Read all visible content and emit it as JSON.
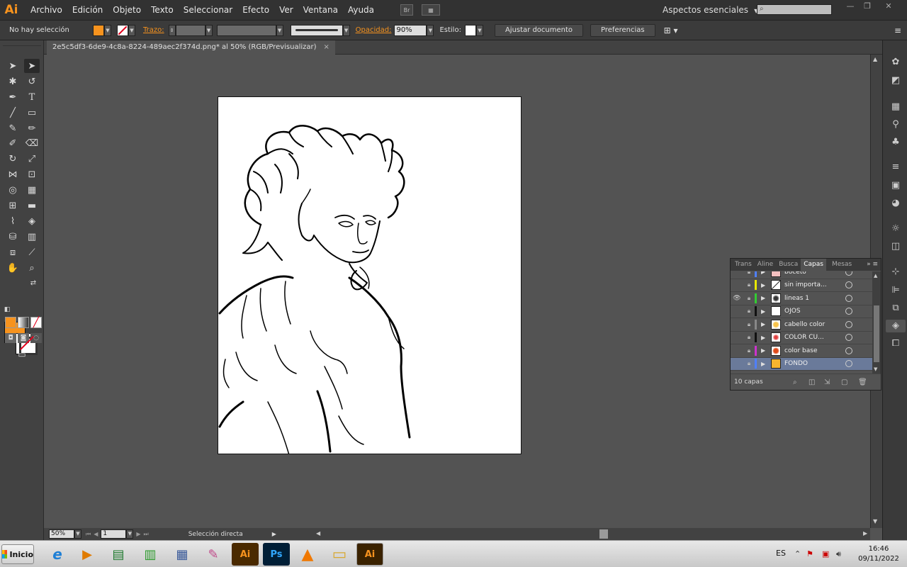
{
  "app": {
    "logo": "Ai",
    "window_controls": [
      "—",
      "❐",
      "✕"
    ]
  },
  "menu": [
    "Archivo",
    "Edición",
    "Objeto",
    "Texto",
    "Seleccionar",
    "Efecto",
    "Ver",
    "Ventana",
    "Ayuda"
  ],
  "menu_buttons": [
    "Br",
    "▦"
  ],
  "workspace": {
    "label": "Aspectos esenciales"
  },
  "control_bar": {
    "selection": "No hay selección",
    "stroke_label": "Trazo:",
    "opacity_label": "Opacidad:",
    "opacity_value": "90%",
    "style_label": "Estilo:",
    "adjust_button": "Ajustar documento",
    "preferences_button": "Preferencias",
    "fill_color": "#f7931e"
  },
  "document_tab": {
    "title": "2e5c5df3-6de9-4c8a-8224-489aec2f374d.png* al 50% (RGB/Previsualizar)",
    "close": "×"
  },
  "status_bar": {
    "zoom": "50%",
    "artboard": "1",
    "tool": "Selección directa"
  },
  "layers_panel": {
    "tabs": [
      "Trans",
      "Aline",
      "Busca",
      "Capas",
      "Mesas"
    ],
    "active_tab": "Capas",
    "layers": [
      {
        "name": "boceto",
        "color": "#4f80ff",
        "visible": false,
        "selected": false
      },
      {
        "name": "sin importa...",
        "color": "#e8e800",
        "visible": false,
        "selected": false
      },
      {
        "name": "lineas 1",
        "color": "#33cc33",
        "visible": true,
        "selected": false
      },
      {
        "name": "OJOS",
        "color": "#111111",
        "visible": false,
        "selected": false
      },
      {
        "name": "cabello color",
        "color": "#888888",
        "visible": false,
        "selected": false
      },
      {
        "name": "COLOR CU...",
        "color": "#111111",
        "visible": false,
        "selected": false
      },
      {
        "name": "color base",
        "color": "#cc33cc",
        "visible": false,
        "selected": false
      },
      {
        "name": "FONDO",
        "color": "#4f80ff",
        "visible": false,
        "selected": true
      }
    ],
    "count": "10 capas"
  },
  "taskbar": {
    "start": "Inicio",
    "apps": [
      "e",
      "▶",
      "▤",
      "▥",
      "▦",
      "✎",
      "Ai",
      "Ps",
      "▲",
      "▭",
      "Ai"
    ],
    "language": "ES",
    "time": "16:46",
    "date": "09/11/2022"
  }
}
